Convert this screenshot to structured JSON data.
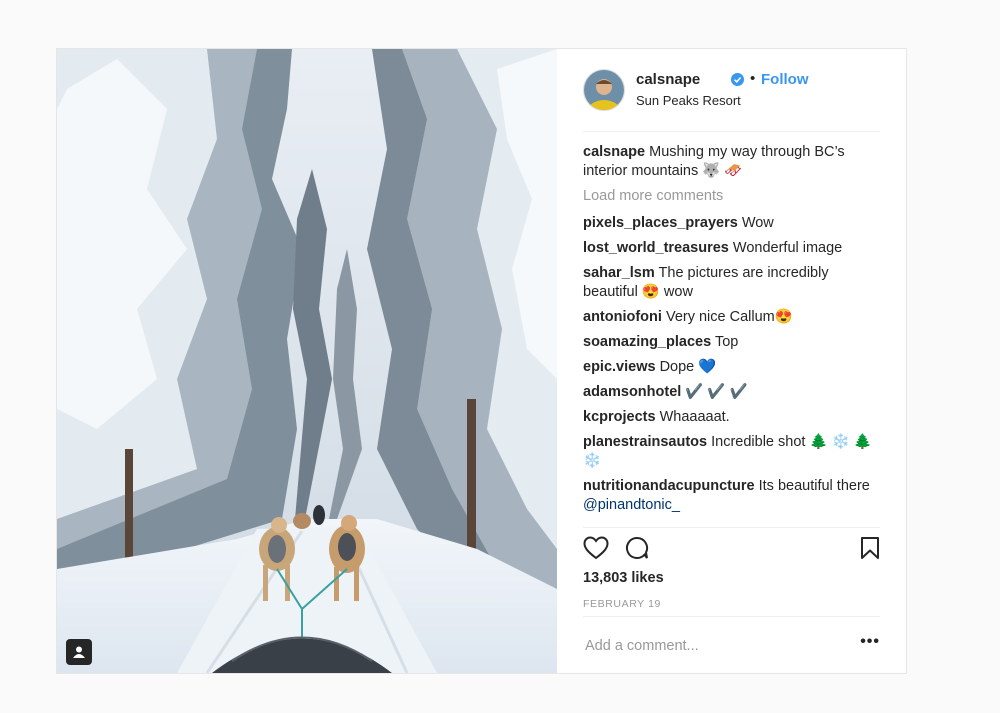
{
  "post": {
    "username": "calsnape",
    "follow_label": "Follow",
    "separator": "•",
    "location": "Sun Peaks Resort",
    "caption": {
      "user": "calsnape",
      "text": "Mushing my way through BC’s interior mountains 🐺 🛷"
    },
    "load_more_label": "Load more comments",
    "comments": [
      {
        "user": "pixels_places_prayers",
        "text": "Wow"
      },
      {
        "user": "lost_world_treasures",
        "text": "Wonderful image"
      },
      {
        "user": "sahar_lsm",
        "text": "The pictures are incredibly beautiful 😍  wow"
      },
      {
        "user": "antoniofoni",
        "text": "Very nice Callum😍"
      },
      {
        "user": "soamazing_places",
        "text": "Top"
      },
      {
        "user": "epic.views",
        "text": "Dope 💙"
      },
      {
        "user": "adamsonhotel",
        "text": "✔️ ✔️ ✔️"
      },
      {
        "user": "kcprojects",
        "text": "Whaaaaat."
      },
      {
        "user": "planestrainsautos",
        "text": "Incredible shot 🌲 ❄️ 🌲 ❄️"
      },
      {
        "user": "nutritionandacupuncture",
        "text": "Its beautiful there",
        "mention": "@pinandtonic_"
      }
    ],
    "likes": "13,803 likes",
    "date": "FEBRUARY 19",
    "comment_placeholder": "Add a comment...",
    "more_label": "•••",
    "icons": {
      "like": "heart-icon",
      "comment": "comment-bubble-icon",
      "save": "bookmark-icon",
      "verified": "verified-badge-icon",
      "tagged": "tagged-user-icon"
    },
    "colors": {
      "link": "#3897f0",
      "muted": "#999999",
      "text": "#262626",
      "mention": "#003569"
    }
  }
}
